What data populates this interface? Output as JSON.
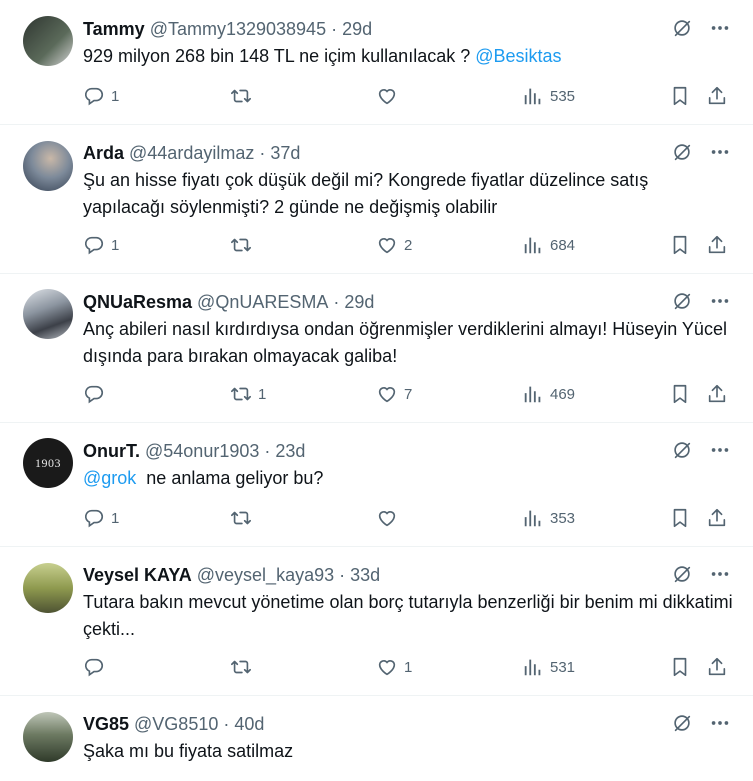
{
  "tweets": [
    {
      "name": "Tammy",
      "handle": "@Tammy1329038945",
      "sep": "·",
      "time": "29d",
      "text": "929 milyon 268 bin 148 TL ne içim kullanılacak ? ",
      "mention_after": "@Besiktas",
      "replies": "1",
      "retweets": "",
      "likes": "",
      "views": "535",
      "avatar_color": "#3a3f3a"
    },
    {
      "name": "Arda",
      "handle": "@44ardayilmaz",
      "sep": "·",
      "time": "37d",
      "text": "Şu an hisse fiyatı çok düşük değil mi? Kongrede fiyatlar düzelince satış yapılacağı söylenmişti? 2 günde ne değişmiş olabilir",
      "replies": "1",
      "retweets": "",
      "likes": "2",
      "views": "684",
      "avatar_color": "#6e7b8a"
    },
    {
      "name": "QNUaResma",
      "handle": "@QnUARESMA",
      "sep": "·",
      "time": "29d",
      "text": "Anç abileri nasıl kırdırdıysa ondan öğrenmişler verdiklerini almayı! Hüseyin Yücel dışında para bırakan olmayacak galiba!",
      "replies": "",
      "retweets": "1",
      "likes": "7",
      "views": "469",
      "avatar_color": "#8a8f96"
    },
    {
      "name": "OnurT.",
      "handle": "@54onur1903",
      "sep": "·",
      "time": "23d",
      "mention_before": "@grok",
      "text": "  ne anlama geliyor bu?",
      "replies": "1",
      "retweets": "",
      "likes": "",
      "views": "353",
      "avatar_color": "#1a1a1a",
      "avatar_text": "1903"
    },
    {
      "name": "Veysel KAYA",
      "handle": "@veysel_kaya93",
      "sep": "·",
      "time": "33d",
      "text": "Tutara bakın mevcut yönetime olan borç tutarıyla benzerliği bir benim mi dikkatimi çekti...",
      "replies": "",
      "retweets": "",
      "likes": "1",
      "views": "531",
      "avatar_color": "#9aa35a"
    },
    {
      "name": "VG85",
      "handle": "@VG8510",
      "sep": "·",
      "time": "40d",
      "text": "Şaka mı bu fiyata satilmaz",
      "avatar_color": "#5f6b55"
    }
  ]
}
